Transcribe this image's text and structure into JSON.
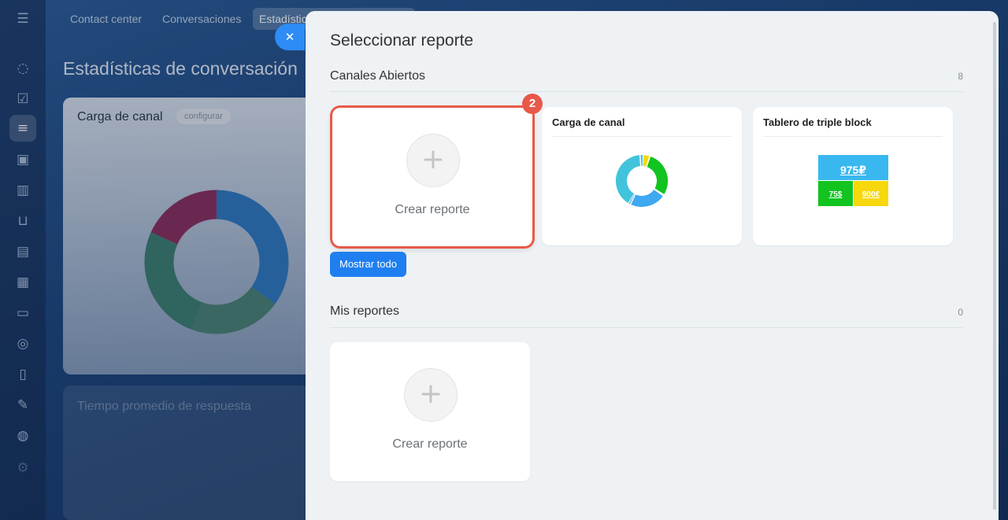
{
  "topnav": {
    "tabs": [
      {
        "label": "Contact center"
      },
      {
        "label": "Conversaciones"
      },
      {
        "label": "Estadístic"
      }
    ]
  },
  "background": {
    "page_title": "Estadísticas de conversación",
    "card1": {
      "title": "Carga de canal",
      "config_label": "configurar"
    },
    "card2": {
      "title": "Tiempo promedio de respuesta"
    }
  },
  "panel": {
    "title": "Seleccionar reporte",
    "open_channels": {
      "title": "Canales Abiertos",
      "count": "8",
      "create_label": "Crear reporte",
      "badge": "2",
      "show_all_label": "Mostrar todo",
      "load_card": {
        "title": "Carga de canal"
      },
      "triple_card": {
        "title": "Tablero de triple block",
        "top_value": "975₽",
        "bottom_left_value": "75$",
        "bottom_right_value": "900€"
      }
    },
    "my_reports": {
      "title": "Mis reportes",
      "count": "0",
      "create_label": "Crear reporte"
    }
  },
  "colors": {
    "accent": "#1f7ff0",
    "highlight": "#e8594a",
    "donut_cyan": "#41c3dc",
    "donut_blue": "#3ea8f0",
    "donut_green": "#12c41f",
    "donut_yellow": "#f6d80d"
  },
  "icons": {
    "sidebar": [
      "menu-icon",
      "feed-icon",
      "tasks-icon",
      "filter-icon",
      "robot-icon",
      "chart-icon",
      "cart-icon",
      "inbox-icon",
      "calendar-icon",
      "drive-icon",
      "target-icon",
      "document-icon",
      "sign-icon",
      "globe-icon",
      "settings-icon"
    ]
  }
}
